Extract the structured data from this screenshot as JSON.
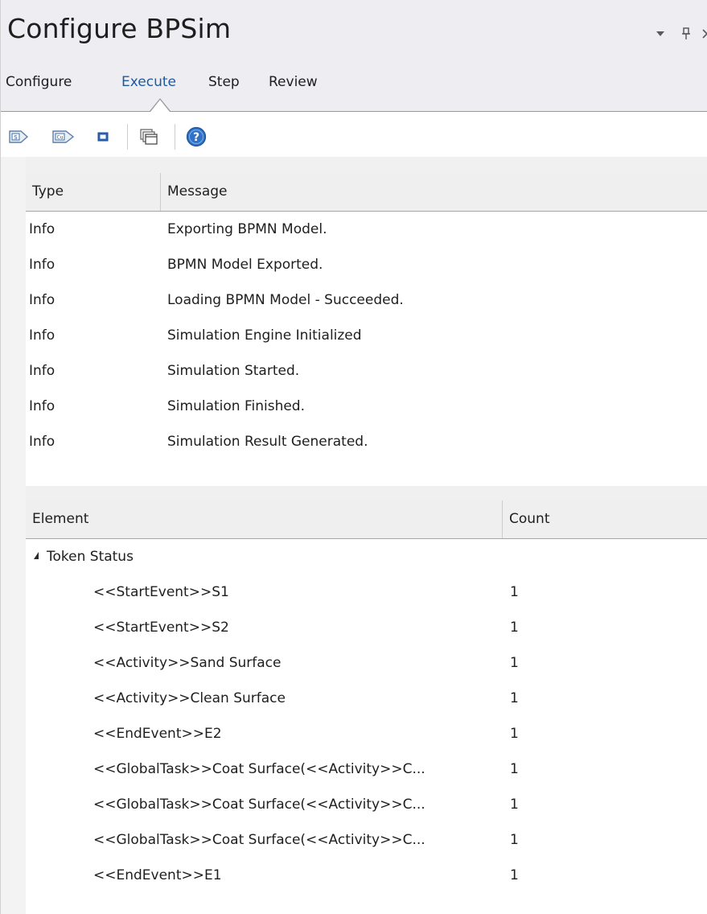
{
  "window": {
    "title": "Configure BPSim",
    "controls": [
      {
        "name": "dropdown-arrow-icon",
        "glyph": "▾"
      },
      {
        "name": "pin-icon",
        "glyph": "ᛘ"
      },
      {
        "name": "close-icon",
        "glyph": "×"
      }
    ]
  },
  "tabs": [
    {
      "label": "Configure",
      "active": false
    },
    {
      "label": "Execute",
      "active": true
    },
    {
      "label": "Step",
      "active": false
    },
    {
      "label": "Review",
      "active": false
    }
  ],
  "toolbar": {
    "buttons": [
      {
        "name": "run-standard-simulation-icon",
        "glyph": "S"
      },
      {
        "name": "run-custom-simulation-icon",
        "glyph": "Cu"
      },
      {
        "name": "stop-simulation-icon",
        "glyph": ""
      },
      {
        "name": "multiple-windows-icon",
        "glyph": ""
      },
      {
        "name": "help-icon",
        "glyph": "?"
      }
    ]
  },
  "messages": {
    "columns": [
      "Type",
      "Message"
    ],
    "rows": [
      [
        "Info",
        "Exporting BPMN Model."
      ],
      [
        "Info",
        "BPMN Model Exported."
      ],
      [
        "Info",
        "Loading BPMN Model - Succeeded."
      ],
      [
        "Info",
        "Simulation Engine Initialized"
      ],
      [
        "Info",
        "Simulation Started."
      ],
      [
        "Info",
        "Simulation Finished."
      ],
      [
        "Info",
        "Simulation Result Generated."
      ]
    ]
  },
  "results": {
    "columns": [
      "Element",
      "Count"
    ],
    "group": "Token Status",
    "rows": [
      [
        "<<StartEvent>>S1",
        "1"
      ],
      [
        "<<StartEvent>>S2",
        "1"
      ],
      [
        "<<Activity>>Sand Surface",
        "1"
      ],
      [
        "<<Activity>>Clean Surface",
        "1"
      ],
      [
        "<<EndEvent>>E2",
        "1"
      ],
      [
        "<<GlobalTask>>Coat Surface(<<Activity>>C...",
        "1"
      ],
      [
        "<<GlobalTask>>Coat Surface(<<Activity>>C...",
        "1"
      ],
      [
        "<<GlobalTask>>Coat Surface(<<Activity>>C...",
        "1"
      ],
      [
        "<<EndEvent>>E1",
        "1"
      ]
    ]
  }
}
